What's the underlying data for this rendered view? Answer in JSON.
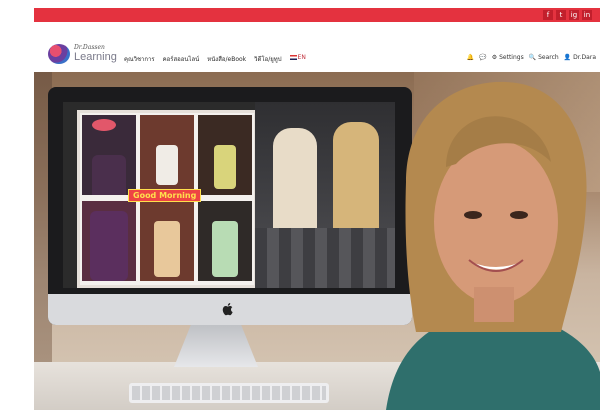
{
  "social": [
    "f",
    "t",
    "ig",
    "in"
  ],
  "logo": {
    "tagline": "Dr.Dassen",
    "name": "Learning"
  },
  "nav": {
    "items": [
      "คุณวิชาการ",
      "คอร์สออนไลน์",
      "หนังสือ/eBook",
      "วิดีโอ/ยูทูป"
    ],
    "lang": "EN"
  },
  "right_nav": {
    "settings": "Settings",
    "search": "Search",
    "user": "Dr.Dara"
  },
  "collage": {
    "banner": "Good Morning"
  },
  "colors": {
    "brand_red": "#e4323f"
  }
}
